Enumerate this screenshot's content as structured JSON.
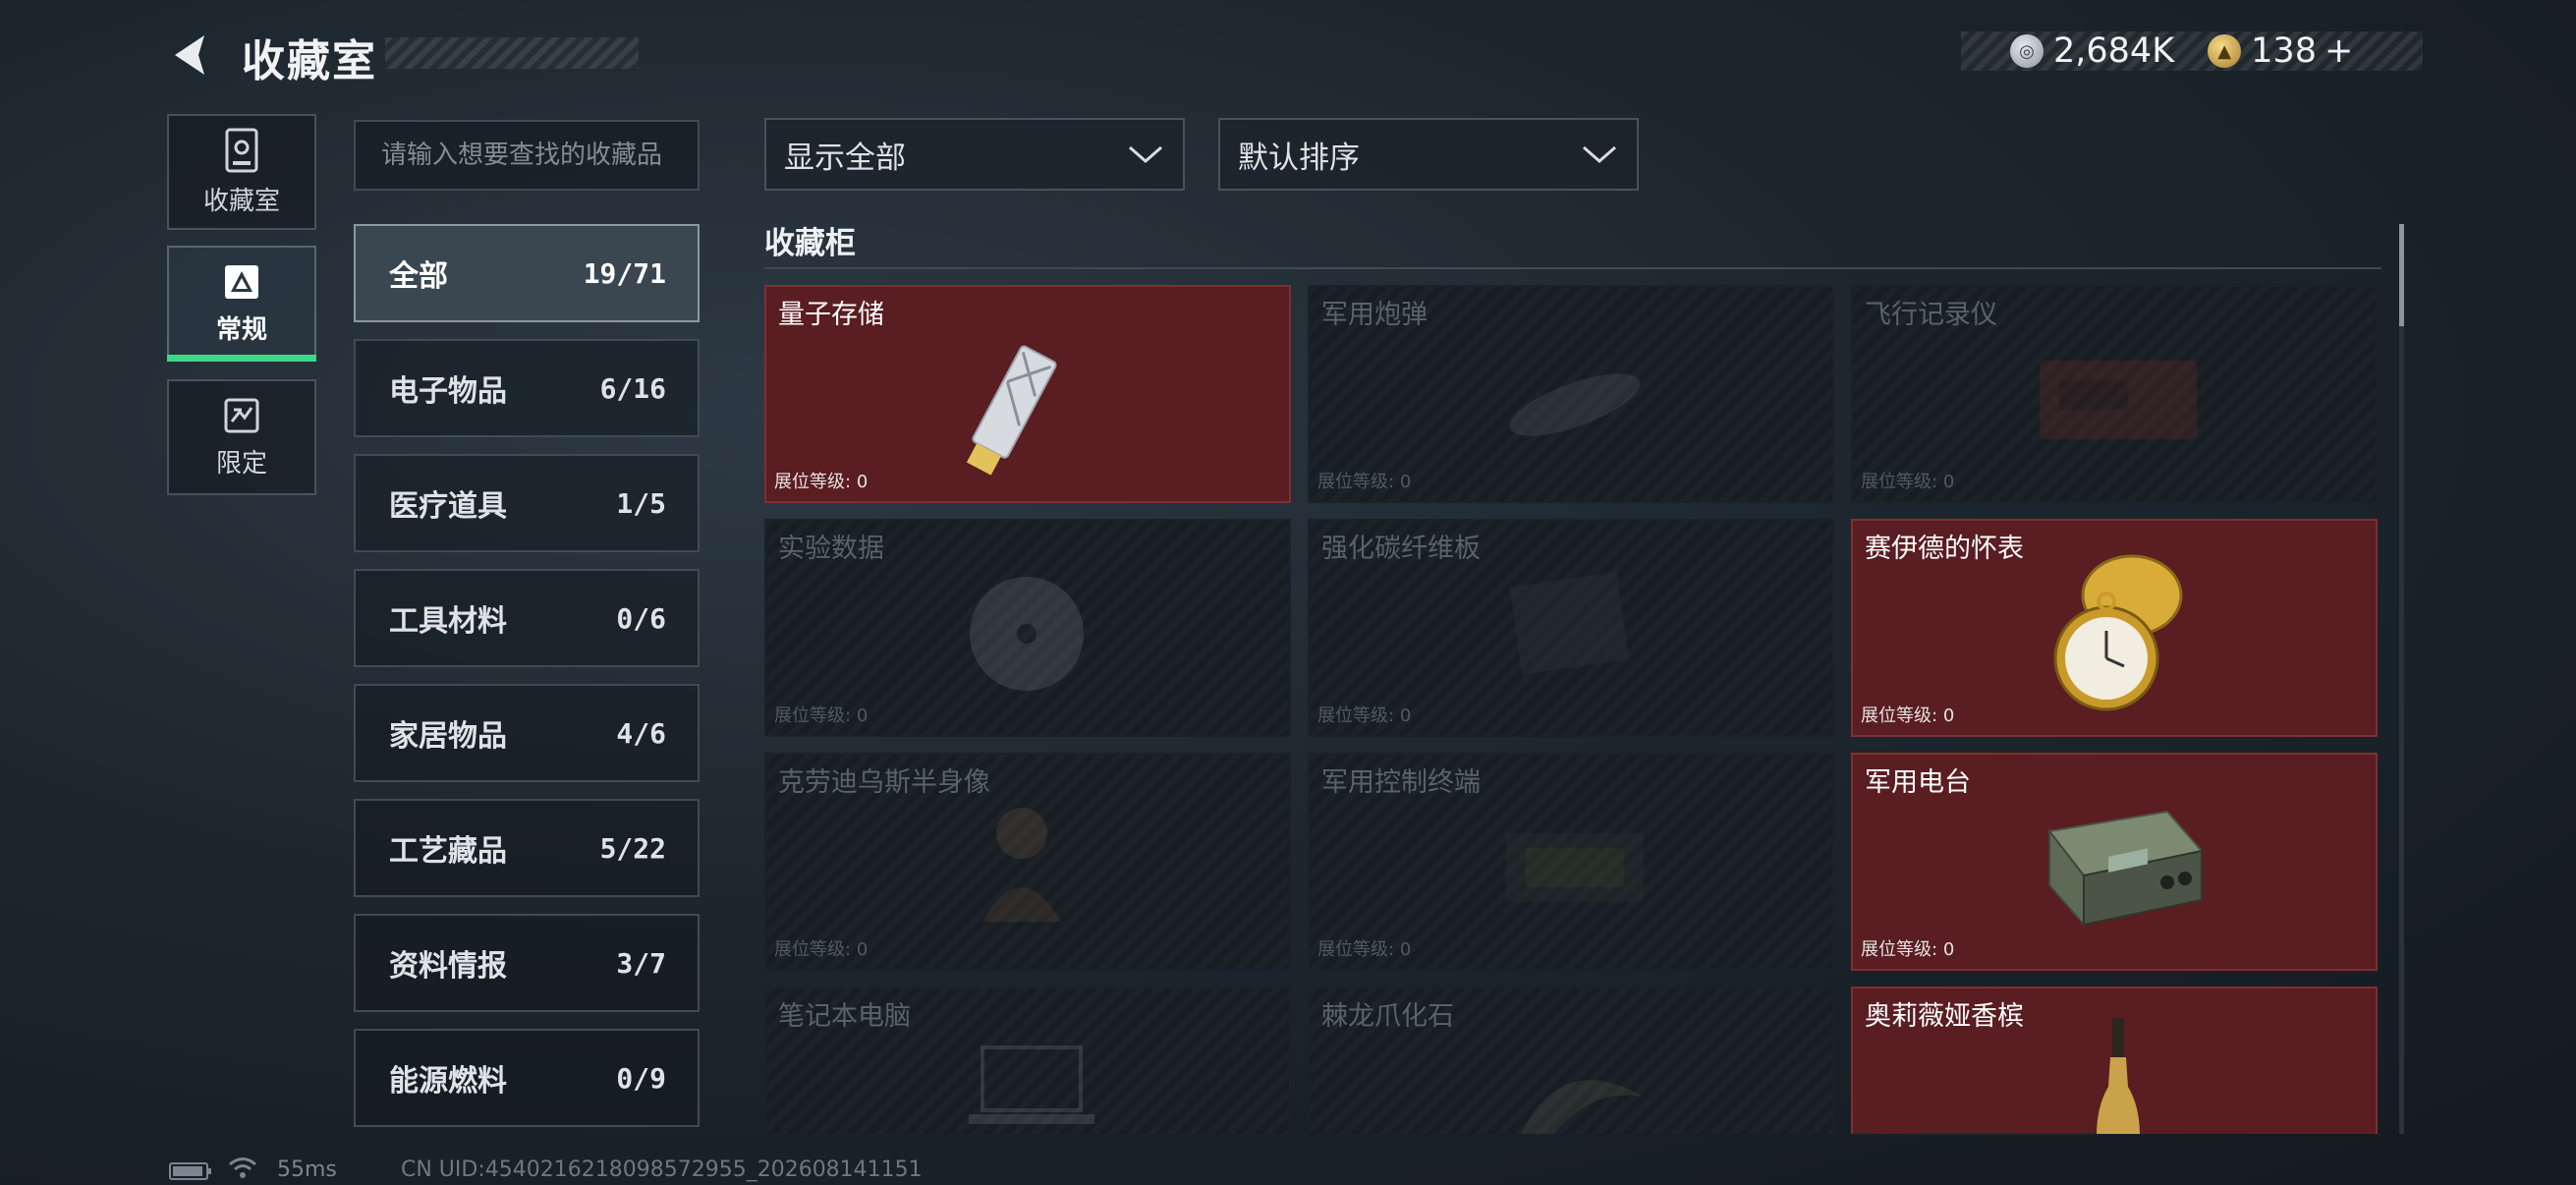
{
  "header": {
    "title": "收藏室",
    "currency": [
      {
        "icon": "silver-coin-icon",
        "value": "2,684K"
      },
      {
        "icon": "gold-coin-icon",
        "value": "138",
        "add": "+"
      }
    ]
  },
  "nav": [
    {
      "icon": "collection-room-icon",
      "label": "收藏室"
    },
    {
      "icon": "regular-icon",
      "label": "常规",
      "active": true
    },
    {
      "icon": "limited-icon",
      "label": "限定"
    }
  ],
  "search": {
    "placeholder": "请输入想要查找的收藏品",
    "value": ""
  },
  "categories": [
    {
      "name": "全部",
      "count": "19/71",
      "active": true
    },
    {
      "name": "电子物品",
      "count": "6/16"
    },
    {
      "name": "医疗道具",
      "count": "1/5"
    },
    {
      "name": "工具材料",
      "count": "0/6"
    },
    {
      "name": "家居物品",
      "count": "4/6"
    },
    {
      "name": "工艺藏品",
      "count": "5/22"
    },
    {
      "name": "资料情报",
      "count": "3/7"
    },
    {
      "name": "能源燃料",
      "count": "0/9"
    }
  ],
  "filters": {
    "show": "显示全部",
    "sort": "默认排序"
  },
  "cabinet": {
    "heading": "收藏柜",
    "level_label": "展位等级:",
    "items": [
      {
        "name": "量子存储",
        "level": "0",
        "owned": true,
        "art": "usb-drive-image"
      },
      {
        "name": "军用炮弹",
        "level": "0",
        "owned": false,
        "art": "artillery-shell-image"
      },
      {
        "name": "飞行记录仪",
        "level": "0",
        "owned": false,
        "art": "flight-recorder-image"
      },
      {
        "name": "实验数据",
        "level": "0",
        "owned": false,
        "art": "data-disc-image"
      },
      {
        "name": "强化碳纤维板",
        "level": "0",
        "owned": false,
        "art": "carbon-plate-image"
      },
      {
        "name": "赛伊德的怀表",
        "level": "0",
        "owned": true,
        "art": "pocket-watch-image"
      },
      {
        "name": "克劳迪乌斯半身像",
        "level": "0",
        "owned": false,
        "art": "bust-statue-image"
      },
      {
        "name": "军用控制终端",
        "level": "0",
        "owned": false,
        "art": "control-terminal-image"
      },
      {
        "name": "军用电台",
        "level": "0",
        "owned": true,
        "art": "military-radio-image"
      },
      {
        "name": "笔记本电脑",
        "level": "",
        "owned": false,
        "art": "laptop-image"
      },
      {
        "name": "棘龙爪化石",
        "level": "",
        "owned": false,
        "art": "claw-fossil-image"
      },
      {
        "name": "奥莉薇娅香槟",
        "level": "",
        "owned": true,
        "art": "champagne-bottle-image"
      }
    ]
  },
  "status": {
    "ping": "55ms",
    "uid": "CN UID:4540216218098572955_202608141151"
  },
  "colors": {
    "accent": "#3ed88a",
    "owned_card": "#5a1d21",
    "background": "#1d262e"
  }
}
